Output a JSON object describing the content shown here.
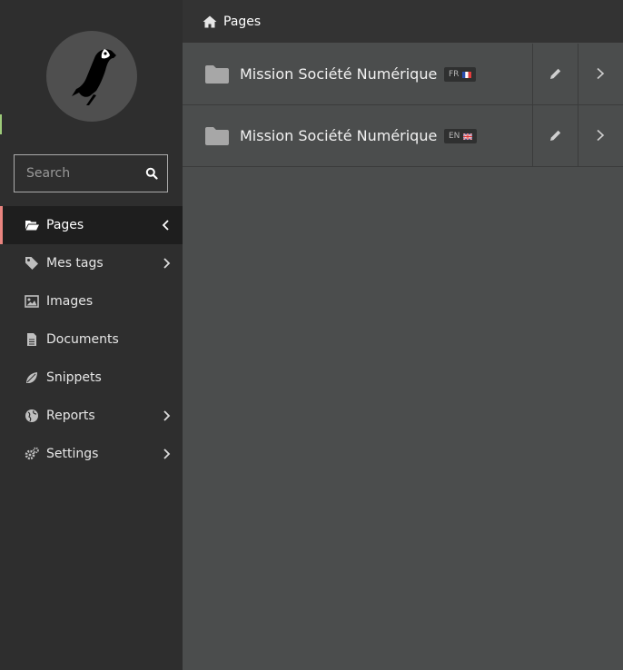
{
  "sidebar": {
    "search": {
      "placeholder": "Search"
    },
    "menu": [
      {
        "label": "Pages",
        "icon": "folder-open-icon",
        "active": true,
        "chevron": "left"
      },
      {
        "label": "Mes tags",
        "icon": "tag-icon",
        "chevron": "right"
      },
      {
        "label": "Images",
        "icon": "image-icon"
      },
      {
        "label": "Documents",
        "icon": "document-icon"
      },
      {
        "label": "Snippets",
        "icon": "snippet-icon"
      },
      {
        "label": "Reports",
        "icon": "globe-icon",
        "chevron": "right"
      },
      {
        "label": "Settings",
        "icon": "cogs-icon",
        "chevron": "right"
      }
    ]
  },
  "header": {
    "breadcrumb": "Pages"
  },
  "pages": [
    {
      "title": "Mission Société Numérique",
      "locale": "FR",
      "flag": "france"
    },
    {
      "title": "Mission Société Numérique",
      "locale": "EN",
      "flag": "uk"
    }
  ],
  "colors": {
    "sidebar_bg": "#2e2e2e",
    "active_item_bg": "#1e1e1e",
    "active_indicator": "#e9847f",
    "content_bg": "#4b4d4d",
    "header_bg": "#333333"
  }
}
